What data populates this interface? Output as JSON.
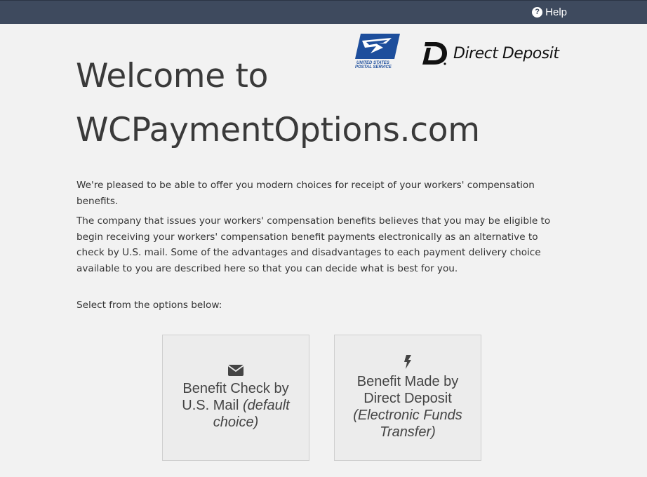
{
  "header": {
    "help_label": "Help",
    "help_icon": "question-circle-icon",
    "bar_color": "#3e4a5e"
  },
  "logos": {
    "usps_text": "UNITED STATES POSTAL SERVICE",
    "direct_deposit_text": "Direct Deposit"
  },
  "main": {
    "title_line1": "Welcome to",
    "title_line2": "WCPaymentOptions.com",
    "intro": "We're pleased to be able to offer you modern choices for receipt of your workers' compensation benefits.",
    "description": "The company that issues your workers' compensation benefits believes that you may be eligible to begin receiving your workers' compensation benefit payments electronically as an alternative to check by U.S. mail. Some of the advantages and disadvantages to each payment delivery choice available to you are described here so that you can decide what is best for you.",
    "select_prompt": "Select from the options below:"
  },
  "options": [
    {
      "icon": "envelope-icon",
      "label": "Benefit Check by U.S. Mail",
      "sub": "(default choice)"
    },
    {
      "icon": "bolt-icon",
      "label": "Benefit Made by Direct Deposit",
      "sub": "(Electronic Funds Transfer)"
    }
  ]
}
